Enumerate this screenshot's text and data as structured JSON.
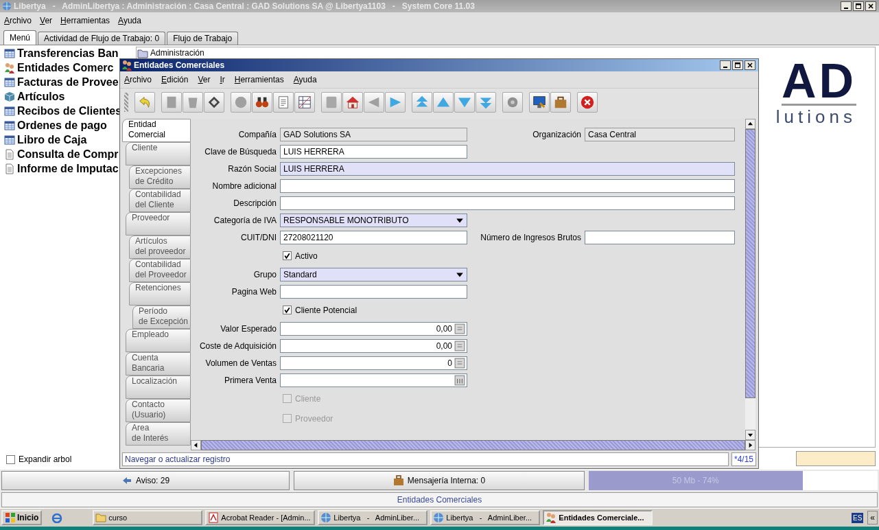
{
  "window": {
    "title": "Libertya   -   AdminLibertya : Administración : Casa Central : GAD Solutions SA @ Libertya1103   -   System Core 11.03"
  },
  "menu": [
    "Archivo",
    "Ver",
    "Herramientas",
    "Ayuda"
  ],
  "tabs": [
    {
      "label": "Menú",
      "selected": true
    },
    {
      "label": "Actividad de Flujo de Trabajo: 0",
      "selected": false
    },
    {
      "label": "Flujo de Trabajo",
      "selected": false
    }
  ],
  "menu_tree": [
    {
      "label": "Transferencias Ban",
      "kind": "window"
    },
    {
      "label": "Entidades Comerc",
      "kind": "people"
    },
    {
      "label": "Facturas de Provee",
      "kind": "window"
    },
    {
      "label": "Artículos",
      "kind": "box"
    },
    {
      "label": "Recibos de Clientes",
      "kind": "window"
    },
    {
      "label": "Ordenes de pago",
      "kind": "window"
    },
    {
      "label": "Libro de Caja",
      "kind": "window"
    },
    {
      "label": "Consulta de Compr",
      "kind": "doc"
    },
    {
      "label": "Informe de Imputac",
      "kind": "doc"
    }
  ],
  "expand_tree": {
    "label": "Expandir arbol",
    "checked": false
  },
  "tree_node": "Administración",
  "logo": {
    "line_1": "AD",
    "line_2": "lutions"
  },
  "inner_window": {
    "title": "Entidades Comerciales",
    "menu": [
      "Archivo",
      "Edición",
      "Ver",
      "Ir",
      "Herramientas",
      "Ayuda"
    ],
    "record_tabs": [
      {
        "label": "Entidad\nComercial",
        "selected": true,
        "children": [
          {
            "label": "Cliente",
            "selected": false,
            "children": [
              {
                "label": "Excepciones\nde Crédito",
                "selected": false
              },
              {
                "label": "Contabilidad\ndel Cliente",
                "selected": false
              }
            ]
          },
          {
            "label": "Proveedor",
            "selected": false,
            "children": [
              {
                "label": "Artículos\ndel proveedor",
                "selected": false
              },
              {
                "label": "Contabilidad\ndel Proveedor",
                "selected": false
              },
              {
                "label": "Retenciones",
                "selected": false,
                "children": [
                  {
                    "label": "Período\nde Excepción",
                    "selected": false
                  }
                ]
              }
            ]
          },
          {
            "label": "Empleado",
            "selected": false
          },
          {
            "label": "Cuenta\nBancaria",
            "selected": false
          },
          {
            "label": "Localización",
            "selected": false
          },
          {
            "label": "Contacto\n(Usuario)",
            "selected": false
          },
          {
            "label": "Area\nde Interés",
            "selected": false
          }
        ]
      }
    ],
    "form_rows": [
      {
        "fields": [
          {
            "kind": "text",
            "label": "Compañía",
            "value": "GAD Solutions SA",
            "readonly": true,
            "mandatory": false
          },
          {
            "kind": "text",
            "label": "Organización",
            "value": "Casa Central",
            "readonly": true,
            "mandatory": false
          }
        ]
      },
      {
        "fields": [
          {
            "kind": "text",
            "label": "Clave de Búsqueda",
            "value": "LUIS HERRERA",
            "readonly": false,
            "mandatory": false
          }
        ]
      },
      {
        "fields": [
          {
            "kind": "long-text",
            "label": "Razón Social",
            "value": "LUIS HERRERA",
            "readonly": false,
            "mandatory": true
          }
        ]
      },
      {
        "fields": [
          {
            "kind": "long-text",
            "label": "Nombre adicional",
            "readonly": false,
            "mandatory": false
          }
        ]
      },
      {
        "fields": [
          {
            "kind": "long-text",
            "label": "Descripción",
            "readonly": false,
            "mandatory": false
          }
        ]
      },
      {
        "fields": [
          {
            "kind": "combo",
            "label": "Categoría de IVA",
            "value": "RESPONSABLE MONOTRIBUTO",
            "readonly": false,
            "mandatory": true
          }
        ]
      },
      {
        "fields": [
          {
            "kind": "text",
            "label": "CUIT/DNI",
            "value": "27208021120",
            "readonly": false,
            "mandatory": false
          },
          {
            "kind": "text",
            "label": "Número de Ingresos Brutos",
            "readonly": false,
            "mandatory": false
          }
        ]
      },
      {
        "fields": [
          {
            "kind": "checkbox",
            "label": "Activo",
            "checked": true,
            "disabled": false
          }
        ]
      },
      {
        "fields": [
          {
            "kind": "combo",
            "label": "Grupo",
            "value": "Standard",
            "readonly": false,
            "mandatory": true
          }
        ]
      },
      {
        "fields": [
          {
            "kind": "text",
            "label": "Pagina Web",
            "readonly": false,
            "mandatory": false
          }
        ]
      },
      {
        "fields": [
          {
            "kind": "checkbox",
            "label": "Cliente Potencial",
            "checked": true,
            "disabled": false
          }
        ]
      },
      {
        "fields": [
          {
            "kind": "number",
            "label": "Valor Esperado",
            "value": "0,00",
            "readonly": false,
            "mandatory": false
          }
        ]
      },
      {
        "fields": [
          {
            "kind": "number",
            "label": "Coste de Adquisición",
            "value": "0,00",
            "readonly": false,
            "mandatory": false
          }
        ]
      },
      {
        "fields": [
          {
            "kind": "number",
            "label": "Volumen de Ventas",
            "value": "0",
            "readonly": false,
            "mandatory": false
          }
        ]
      },
      {
        "fields": [
          {
            "kind": "date",
            "label": "Primera Venta",
            "readonly": false,
            "mandatory": false
          }
        ]
      },
      {
        "fields": [
          {
            "kind": "checkbox",
            "label": "Cliente",
            "checked": false,
            "disabled": true
          }
        ]
      },
      {
        "fields": [
          {
            "kind": "checkbox",
            "label": "Proveedor",
            "checked": false,
            "disabled": true
          }
        ]
      }
    ],
    "status": "Navegar o actualizar registro",
    "record_count": "*4/15"
  },
  "bottom_bar": {
    "notice": "Aviso: 29",
    "messages": "Mensajería Interna: 0",
    "memory": {
      "reading": "50 Mb - 74%",
      "level": 0.74
    }
  },
  "status_label": "Entidades Comerciales",
  "taskbar": {
    "start": "Inicio",
    "items": [
      {
        "label": "curso",
        "kind": "folder",
        "selected": false
      },
      {
        "label": "Acrobat Reader - [Admin...",
        "kind": "acrobat",
        "selected": false
      },
      {
        "label": "Libertya   -   AdminLiber...",
        "kind": "globe",
        "selected": false
      },
      {
        "label": "Libertya   -   AdminLiber...",
        "kind": "globe",
        "selected": false
      },
      {
        "label": "Entidades Comerciale...",
        "kind": "people",
        "selected": true
      }
    ],
    "language": "ES",
    "collapse": "«"
  }
}
